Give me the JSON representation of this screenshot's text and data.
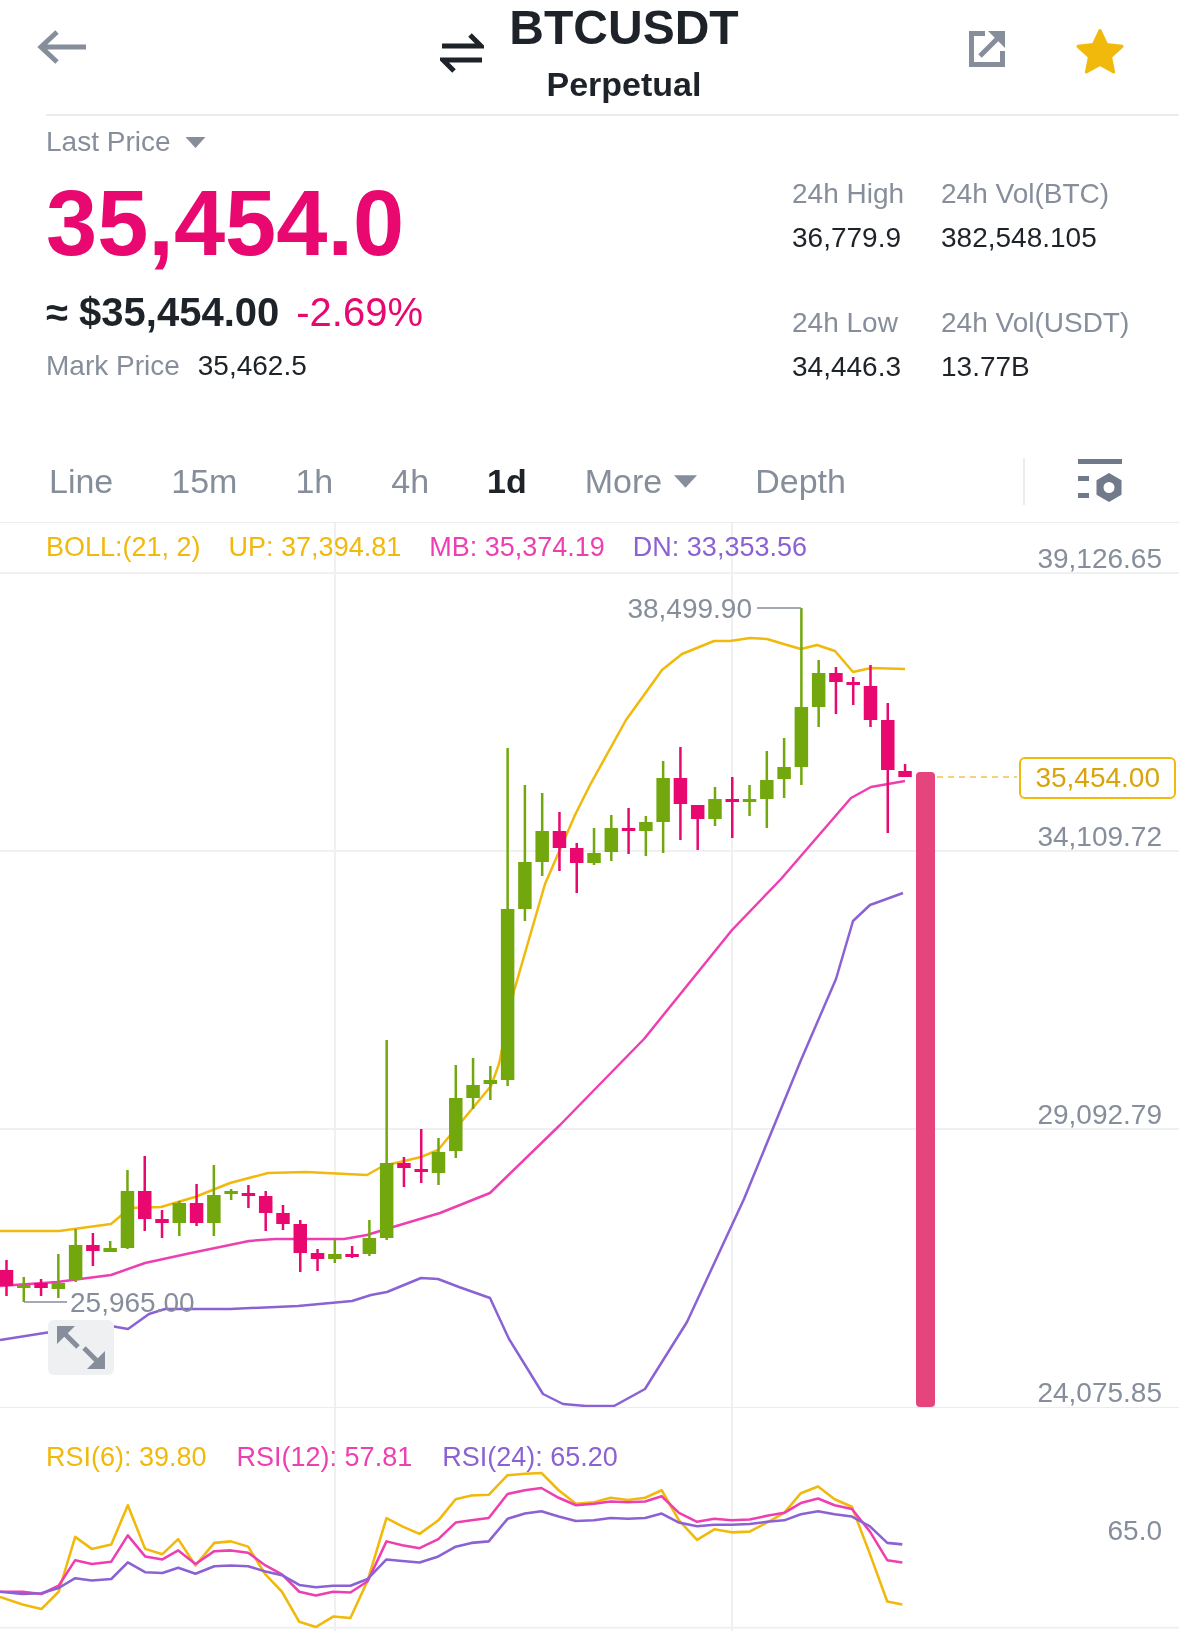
{
  "header": {
    "title": "BTCUSDT",
    "subtitle": "Perpetual",
    "favorite": true
  },
  "price": {
    "label": "Last Price",
    "falling": true,
    "last": "35,454.0",
    "approx": "≈ $35,454.00",
    "change": "-2.69%",
    "mark_label": "Mark Price",
    "mark": "35,462.5"
  },
  "stats": [
    {
      "label": "24h High",
      "value": "36,779.9"
    },
    {
      "label": "24h Vol(BTC)",
      "value": "382,548.105"
    },
    {
      "label": "24h Low",
      "value": "34,446.3"
    },
    {
      "label": "24h Vol(USDT)",
      "value": "13.77B"
    }
  ],
  "tabs": [
    {
      "label": "Line",
      "kind": "tab",
      "selected": false
    },
    {
      "label": "15m",
      "kind": "tab",
      "selected": false
    },
    {
      "label": "1h",
      "kind": "tab",
      "selected": false
    },
    {
      "label": "4h",
      "kind": "tab",
      "selected": false
    },
    {
      "label": "1d",
      "kind": "tab",
      "selected": true
    },
    {
      "label": "More",
      "kind": "dropdown",
      "selected": false
    },
    {
      "label": "Depth",
      "kind": "tab",
      "selected": false
    }
  ],
  "chart": {
    "indicator": {
      "label": "BOLL:(21, 2)",
      "lines": [
        {
          "label": "UP: 37,394.81",
          "color": "#f0b90b"
        },
        {
          "label": "MB: 35,374.19",
          "color": "#ee3fb1"
        },
        {
          "label": "DN: 33,353.56",
          "color": "#8b62d3"
        }
      ]
    },
    "y_axis": [
      "39,126.65",
      "34,109.72",
      "29,092.79",
      "24,075.85"
    ],
    "high_label": "38,499.90",
    "low_label": "25,965.00",
    "last_price_tag": "35,454.00"
  },
  "rsi": {
    "lines": [
      {
        "label": "RSI(6): 39.80",
        "color": "#f0b90b"
      },
      {
        "label": "RSI(12): 57.81",
        "color": "#ee3fb1"
      },
      {
        "label": "RSI(24): 65.20",
        "color": "#8b62d3"
      }
    ],
    "y_axis": [
      "65.0"
    ]
  }
}
